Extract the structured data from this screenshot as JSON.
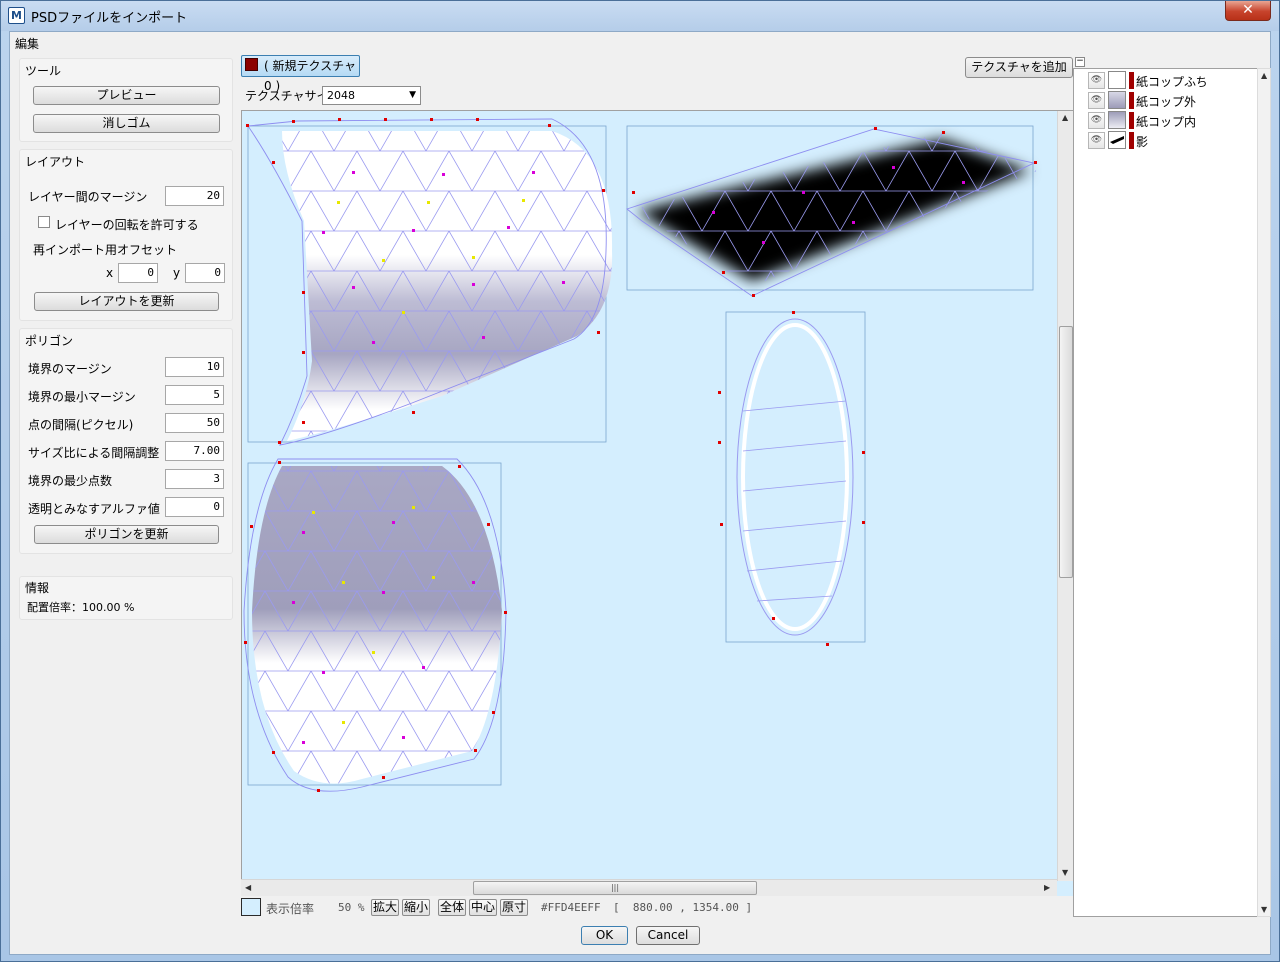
{
  "window": {
    "title": "PSDファイルをインポート",
    "app_icon": "M",
    "close_glyph": "✕"
  },
  "menu": {
    "edit": "編集"
  },
  "tools": {
    "title": "ツール",
    "preview": "プレビュー",
    "eraser": "消しゴム"
  },
  "layout": {
    "title": "レイアウト",
    "margin_label": "レイヤー間のマージン",
    "margin_value": "20",
    "allow_rotation_label": "レイヤーの回転を許可する",
    "allow_rotation_checked": false,
    "offset_label": "再インポート用オフセット",
    "x_label": "x",
    "x_value": "0",
    "y_label": "y",
    "y_value": "0",
    "update_button": "レイアウトを更新"
  },
  "polygon": {
    "title": "ポリゴン",
    "fields": [
      {
        "label": "境界のマージン",
        "value": "10"
      },
      {
        "label": "境界の最小マージン",
        "value": "5"
      },
      {
        "label": "点の間隔(ピクセル)",
        "value": "50"
      },
      {
        "label": "サイズ比による間隔調整",
        "value": "7.00"
      },
      {
        "label": "境界の最少点数",
        "value": "3"
      },
      {
        "label": "透明とみなすアルファ値",
        "value": "0"
      }
    ],
    "update_button": "ポリゴンを更新"
  },
  "info": {
    "title": "情報",
    "scale_text": "配置倍率：100.00 %"
  },
  "texture": {
    "tab_label": "( 新規テクスチャ 0 )",
    "tab_color": "#8b0000",
    "add_button": "テクスチャを追加",
    "size_label": "テクスチャサイズ",
    "size_value": "2048"
  },
  "status": {
    "zoom_label": "表示倍率",
    "zoom_value": "50 %",
    "zoom_in": "拡大",
    "zoom_out": "縮小",
    "fit_all": "全体",
    "center": "中心",
    "actual_size": "原寸",
    "color_value": "#FFD4EEFF",
    "coords": "[  880.00 , 1354.00 ]",
    "background_color": "#d4eefe"
  },
  "layers": {
    "collapse_glyph": "−",
    "items": [
      {
        "name": "紙コップふち",
        "thumb": "white"
      },
      {
        "name": "紙コップ外",
        "thumb": "gray-gradient"
      },
      {
        "name": "紙コップ内",
        "thumb": "gray"
      },
      {
        "name": "影",
        "thumb": "black-shape"
      }
    ]
  },
  "dialog": {
    "ok": "OK",
    "cancel": "Cancel"
  }
}
